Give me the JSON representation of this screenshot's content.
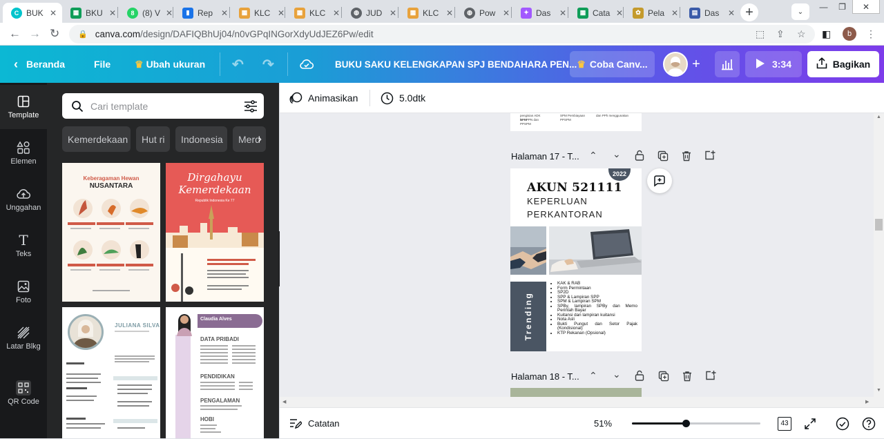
{
  "tabs": [
    {
      "title": "BUK",
      "icon": "canva-icon",
      "color": "#00c4cc"
    },
    {
      "title": "BKU",
      "icon": "sheets-icon",
      "color": "#0f9d58"
    },
    {
      "title": "(8) V",
      "icon": "whatsapp-icon",
      "color": "#25d366"
    },
    {
      "title": "Rep",
      "icon": "doc-icon",
      "color": "#1a73e8"
    },
    {
      "title": "KLC",
      "icon": "klc-icon",
      "color": "#e8a23c"
    },
    {
      "title": "KLC",
      "icon": "klc-icon",
      "color": "#e8a23c"
    },
    {
      "title": "JUD",
      "icon": "globe-icon",
      "color": "#5f6368"
    },
    {
      "title": "KLC",
      "icon": "klc-icon",
      "color": "#e8a23c"
    },
    {
      "title": "Pow",
      "icon": "globe-icon",
      "color": "#5f6368"
    },
    {
      "title": "Das",
      "icon": "figma-icon",
      "color": "#a259ff"
    },
    {
      "title": "Cata",
      "icon": "sheets-icon",
      "color": "#0f9d58"
    },
    {
      "title": "Pela",
      "icon": "emblem-icon",
      "color": "#c49a2c"
    },
    {
      "title": "Das",
      "icon": "dashboard-icon",
      "color": "#3b5ba9"
    }
  ],
  "address": {
    "url_host": "canva.com",
    "url_path": "/design/DAFIQBhUj04/n0vGPqINGorXdyUdJEZ6Pw/edit"
  },
  "profile_initial": "b",
  "toolbar": {
    "home": "Beranda",
    "file": "File",
    "resize": "Ubah ukuran",
    "title": "BUKU SAKU KELENGKAPAN SPJ BENDAHARA PEN...",
    "try_canva": "Coba Canv...",
    "play_time": "3:34",
    "share": "Bagikan"
  },
  "rail": [
    "Template",
    "Elemen",
    "Unggahan",
    "Teks",
    "Foto",
    "Latar Blkg",
    "QR Code"
  ],
  "panel": {
    "search_placeholder": "Cari template",
    "chips": [
      "Kemerdekaan",
      "Hut ri",
      "Indonesia",
      "Merd"
    ]
  },
  "templates": {
    "t1": {
      "title_a": "Keberagaman Hewan",
      "title_b": "NUSANTARA"
    },
    "t2": {
      "title_a": "Dirgahayu",
      "title_b": "Kemerdekaan",
      "sub": "Republik Indonesia Ke 77"
    },
    "t3": {
      "name": "JULIANA SILVA"
    },
    "t4": {
      "name": "Claudia Alves",
      "s1": "DATA PRIBADI",
      "s2": "PENDIDIKAN",
      "s3": "PENGALAMAN",
      "s4": "HOBI"
    }
  },
  "canvas": {
    "animate": "Animasikan",
    "duration": "5.0dtk"
  },
  "pages": {
    "p17_label": "Halaman 17 - T...",
    "p18_label": "Halaman 18 - T...",
    "year": "2022",
    "akun": "AKUN 521111",
    "keperluan1": "KEPERLUAN",
    "keperluan2": "PERKANTORAN",
    "trending": "Trending",
    "list": [
      "KAK & RAB",
      "Form Permintaan",
      "SP2D",
      "SPP & Lampiran SPP",
      "SPM & Lampiran SPM",
      "SPBy, lampiran SPBy dan Memo Perintah Bayar",
      "Kuitansi dan lampiran kuitansi",
      "Nota Asli",
      "Bukti Pungut dan Setor Pajak (Kondisional)",
      "KTP Rekanan (Opsional)"
    ],
    "prev_text": [
      "pengisian ADK SPM",
      "SPM Pembiayaan",
      "dan PPh menggunakan",
      "ke KPPN dan PPSPM",
      "PPSPM",
      "NTPN"
    ]
  },
  "bottom": {
    "notes": "Catatan",
    "zoom": "51%",
    "zoom_fraction": 0.42,
    "page_count": "43"
  }
}
